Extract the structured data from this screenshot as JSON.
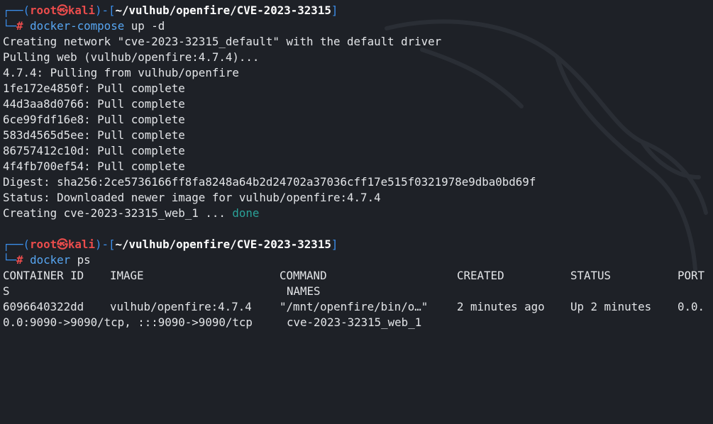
{
  "prompt": {
    "user": "root",
    "symbol": "㉿",
    "host": "kali",
    "cwd": "~/vulhub/openfire/CVE-2023-32315",
    "top_prefix": "┌──(",
    "top_mid": ")-[",
    "top_suffix": "]",
    "bottom_prefix": "└─",
    "hash": "#"
  },
  "command1": {
    "bin": "docker-compose",
    "args": "up -d"
  },
  "output1": [
    "Creating network \"cve-2023-32315_default\" with the default driver",
    "Pulling web (vulhub/openfire:4.7.4)...",
    "4.7.4: Pulling from vulhub/openfire",
    "1fe172e4850f: Pull complete",
    "44d3aa8d0766: Pull complete",
    "6ce99fdf16e8: Pull complete",
    "583d4565d5ee: Pull complete",
    "86757412c10d: Pull complete",
    "4f4fb700ef54: Pull complete",
    "Digest: sha256:2ce5736166ff8fa8248a64b2d24702a37036cff17e515f0321978e9dba0bd69f",
    "Status: Downloaded newer image for vulhub/openfire:4.7.4"
  ],
  "creating_line": {
    "text": "Creating cve-2023-32315_web_1 ... ",
    "status": "done"
  },
  "command2": {
    "bin": "docker",
    "args": "ps"
  },
  "ps_table": {
    "header": {
      "container_id": "CONTAINER ID",
      "image": "IMAGE",
      "command": "COMMAND",
      "created": "CREATED",
      "status": "STATUS",
      "ports_head": "PORT",
      "ports_tail": "S",
      "names": "NAMES"
    },
    "row": {
      "container_id": "6096640322dd",
      "image": "vulhub/openfire:4.7.4",
      "command": "\"/mnt/openfire/bin/o…\"",
      "created": "2 minutes ago",
      "status": "Up 2 minutes",
      "ports_head": "0.0.",
      "ports_tail": "0.0:9090->9090/tcp, :::9090->9090/tcp",
      "names": "cve-2023-32315_web_1"
    }
  }
}
